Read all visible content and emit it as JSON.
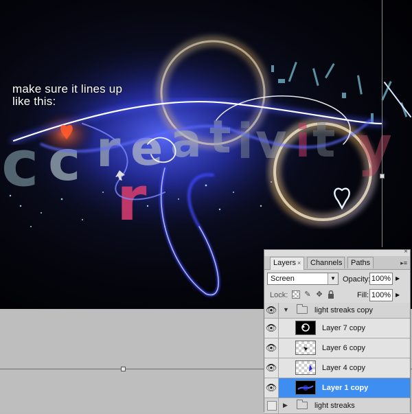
{
  "artwork": {
    "instruction_line1": "make sure it lines up",
    "instruction_line2": "like this:",
    "background_color": "#000000",
    "glow_color": "#3a4dff"
  },
  "layers_panel": {
    "close_icon": "×",
    "tabs": [
      {
        "label": "Layers",
        "active": true,
        "close_icon": "×"
      },
      {
        "label": "Channels",
        "active": false
      },
      {
        "label": "Paths",
        "active": false
      }
    ],
    "menu_icon": "▸≡",
    "blend_mode": "Screen",
    "opacity_label": "Opacity:",
    "opacity_value": "100%",
    "lock_label": "Lock:",
    "lock_icons": [
      "lock-transparent-pixels-icon",
      "lock-image-pixels-icon",
      "lock-position-icon",
      "lock-all-icon"
    ],
    "fill_label": "Fill:",
    "fill_value": "100%",
    "layers": [
      {
        "name": "light streaks copy",
        "type": "group",
        "visible": true,
        "expanded": true
      },
      {
        "name": "Layer 7 copy",
        "type": "layer",
        "visible": true,
        "selected": false
      },
      {
        "name": "Layer 6 copy",
        "type": "layer",
        "visible": true,
        "selected": false
      },
      {
        "name": "Layer 4 copy",
        "type": "layer",
        "visible": true,
        "selected": false
      },
      {
        "name": "Layer 1 copy",
        "type": "layer",
        "visible": true,
        "selected": true
      },
      {
        "name": "light streaks",
        "type": "group",
        "visible": false,
        "expanded": false
      }
    ],
    "selection_color": "#3e8ef2"
  }
}
